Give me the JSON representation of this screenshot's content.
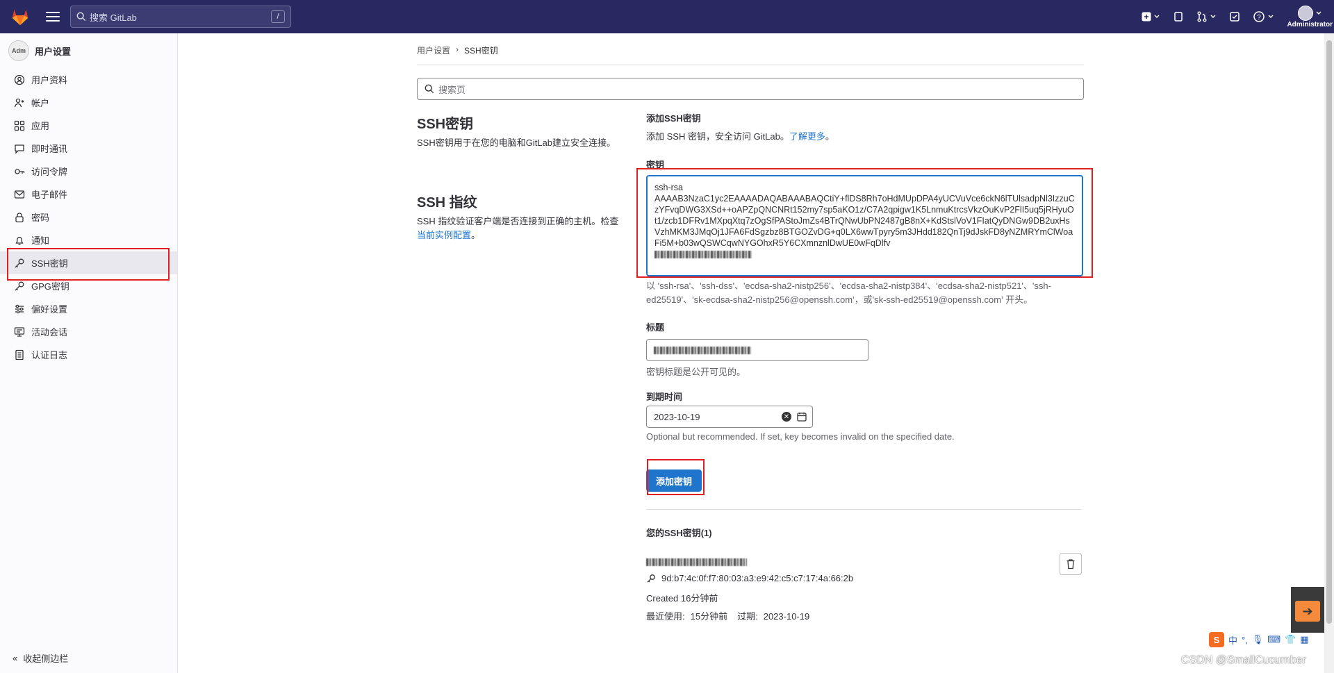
{
  "topbar": {
    "search_placeholder": "搜索 GitLab",
    "search_shortcut": "/",
    "user_label": "Administrator"
  },
  "sidebar": {
    "header": "用户设置",
    "avatar_alt": "Adm",
    "items": [
      {
        "label": "用户资料",
        "icon": "profile-icon"
      },
      {
        "label": "帐户",
        "icon": "account-icon"
      },
      {
        "label": "应用",
        "icon": "applications-icon"
      },
      {
        "label": "即时通讯",
        "icon": "chat-icon"
      },
      {
        "label": "访问令牌",
        "icon": "token-icon"
      },
      {
        "label": "电子邮件",
        "icon": "email-icon"
      },
      {
        "label": "密码",
        "icon": "lock-icon"
      },
      {
        "label": "通知",
        "icon": "bell-icon"
      },
      {
        "label": "SSH密钥",
        "icon": "key-icon"
      },
      {
        "label": "GPG密钥",
        "icon": "key-icon"
      },
      {
        "label": "偏好设置",
        "icon": "preferences-icon"
      },
      {
        "label": "活动会话",
        "icon": "session-icon"
      },
      {
        "label": "认证日志",
        "icon": "log-icon"
      }
    ],
    "active_item": "SSH密钥",
    "collapse_label": "收起侧边栏"
  },
  "breadcrumb": {
    "parent": "用户设置",
    "sep": "›",
    "current": "SSH密钥"
  },
  "page_search_placeholder": "搜索页",
  "ssh_keys_section": {
    "title": "SSH密钥",
    "description": "SSH密钥用于在您的电脑和GitLab建立安全连接。"
  },
  "fingerprint_section": {
    "title": "SSH 指纹",
    "description_prefix": "SSH 指纹验证客户端是否连接到正确的主机。检查",
    "description_link": "当前实例配置",
    "description_suffix": "。"
  },
  "add_form": {
    "heading": "添加SSH密钥",
    "subtitle_prefix": "添加 SSH 密钥，安全访问 GitLab。",
    "subtitle_link": "了解更多",
    "subtitle_suffix": "。",
    "key_label": "密钥",
    "key_value": "ssh-rsa\nAAAAB3NzaC1yc2EAAAADAQABAAABAQCtiY+flDS8Rh7oHdMUpDPA4yUCVuVce6ckN6lTUlsadpNl3IzzuCzYFvqDWG3XSd++oAPZpQNCNRt152my7sp5aKO1z/C7A2qpigw1K5LnmuKtrcsVkzOuKvP2FlI5uq5jRHyuOt1/zcb1DFRv1MXpqXtq7zOgSfPAStoJmZs4BTrQNwUbPN2487gB8nX+KdStslVoV1FIatQyDNGw9DB2uxHsVzhMKM3JMqOj1JFA6FdSgzbz8BTGOZvDG+q0LX6wwTpyry5m3JHdd182QnTj9dJskFD8yNZMRYmClWoaFi5M+b03wQSWCqwNYGOhxR5Y6CXmnznlDwUE0wFqDlfv",
    "key_help": "以 'ssh-rsa'、'ssh-dss'、'ecdsa-sha2-nistp256'、'ecdsa-sha2-nistp384'、'ecdsa-sha2-nistp521'、'ssh-ed25519'、'sk-ecdsa-sha2-nistp256@openssh.com'，或'sk-ssh-ed25519@openssh.com' 开头。",
    "title_label": "标题",
    "title_help": "密钥标题是公开可见的。",
    "expiry_label": "到期时间",
    "expiry_value": "2023-10-19",
    "expiry_help": "Optional but recommended. If set, key becomes invalid on the specified date.",
    "submit_label": "添加密钥"
  },
  "your_keys": {
    "heading": "您的SSH密钥(1)",
    "fingerprint": "9d:b7:4c:0f:f7:80:03:a3:e9:42:c5:c7:17:4a:66:2b",
    "created": "Created 16分钟前",
    "last_used_label": "最近使用:",
    "last_used_value": "15分钟前",
    "expires_label": "过期:",
    "expires_value": "2023-10-19"
  },
  "overlay": {
    "ime_text": "中",
    "watermark": "CSDN @SmallCucumber"
  },
  "colors": {
    "topbar": "#292961",
    "accent": "#1f75cb",
    "highlight_box": "#e02020"
  }
}
